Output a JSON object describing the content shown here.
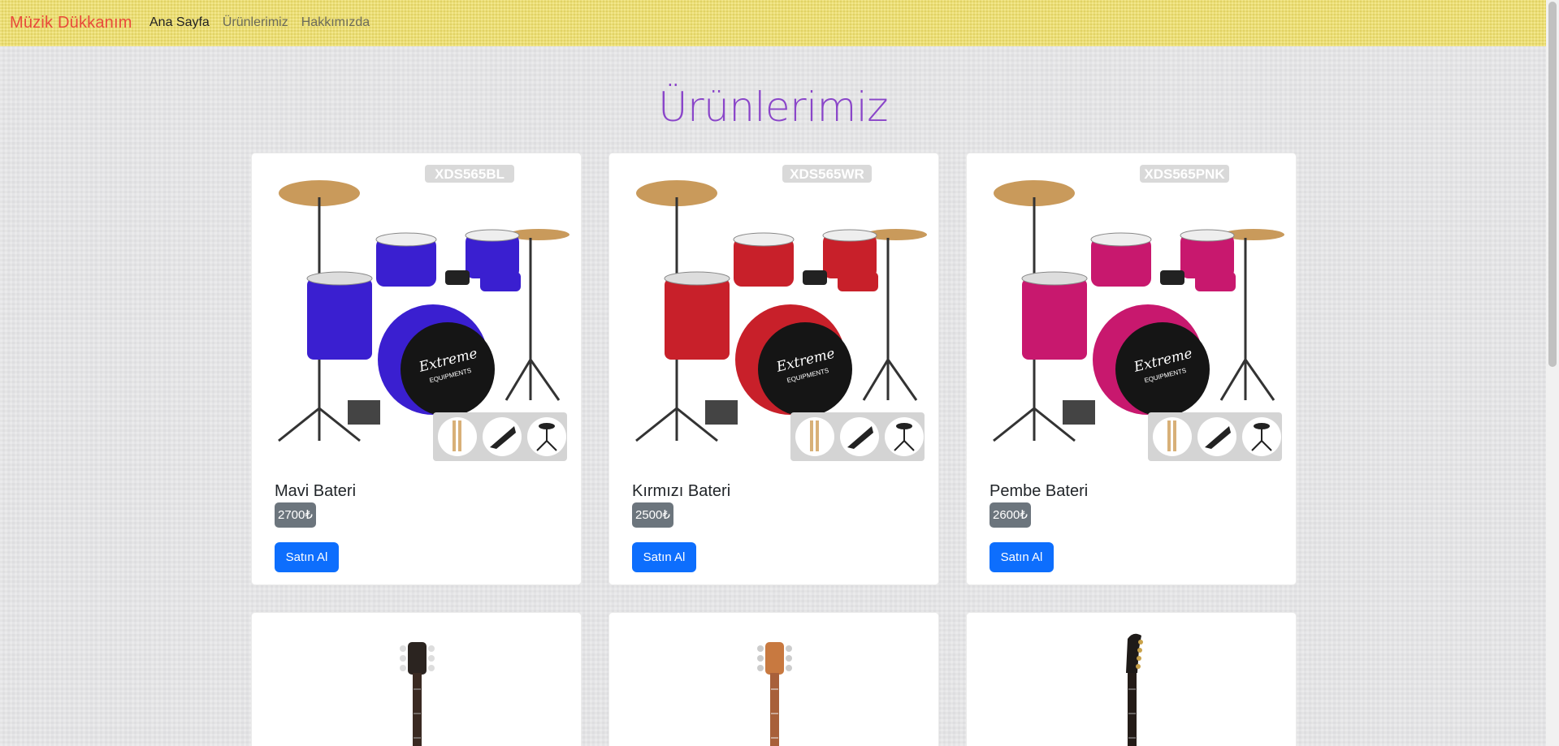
{
  "nav": {
    "brand": "Müzik Dükkanım",
    "links": [
      "Ana Sayfa",
      "Ürünlerimiz",
      "Hakkımızda"
    ]
  },
  "page": {
    "title": "Ürünlerimiz"
  },
  "products": [
    {
      "name": "Mavi Bateri",
      "price": "2700₺",
      "button": "Satın Al",
      "model": "XDS565BL",
      "brand_text": "Extreme EQUIPMENTS"
    },
    {
      "name": "Kırmızı Bateri",
      "price": "2500₺",
      "button": "Satın Al",
      "model": "XDS565WR",
      "brand_text": "Extreme EQUIPMENTS"
    },
    {
      "name": "Pembe Bateri",
      "price": "2600₺",
      "button": "Satın Al",
      "model": "XDS565PNK",
      "brand_text": "Extreme EQUIPMENTS"
    }
  ],
  "colors": {
    "navbar": "#efe06a",
    "brand": "#e84a3a",
    "title": "#8a45c9",
    "button": "#0d6efd",
    "badge": "#6c757d",
    "drum_blue": "#3a1fd0",
    "drum_red": "#c8202a",
    "drum_pink": "#c8186e"
  }
}
